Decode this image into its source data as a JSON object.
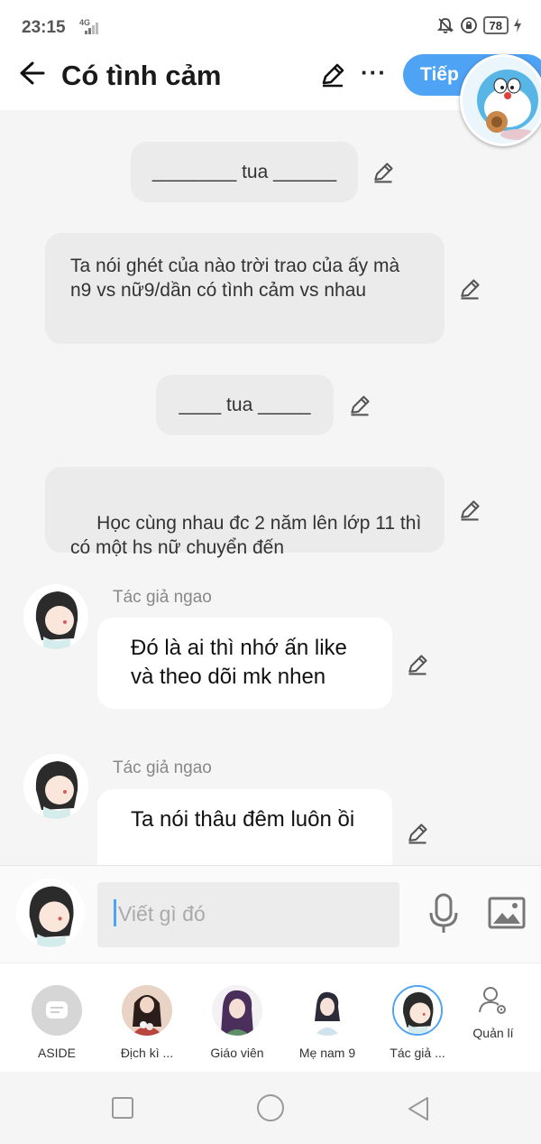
{
  "status_bar": {
    "time": "23:15",
    "network": "4G",
    "battery": "78"
  },
  "header": {
    "title": "Có tình cảm",
    "next_label": "Tiếp"
  },
  "messages": [
    {
      "text": "________ tua ______"
    },
    {
      "text": "Ta nói ghét của nào trời trao của ấy mà n9 vs nữ9/dần có tình cảm vs nhau"
    },
    {
      "text": "____ tua _____"
    },
    {
      "text": " Học cùng nhau đc 2 năm lên lớp 11 thì có một hs nữ chuyển đến"
    },
    {
      "author": "Tác giả ngao",
      "text": "Đó là ai thì nhớ ấn like và theo dõi mk nhen"
    },
    {
      "author": "Tác giả ngao",
      "text": "Ta nói thâu đêm luôn ồi"
    }
  ],
  "composer": {
    "placeholder": "Viết gì đó"
  },
  "characters": [
    {
      "name": "ASIDE"
    },
    {
      "name": "Địch kì ..."
    },
    {
      "name": "Giáo viên"
    },
    {
      "name": "Mẹ nam 9"
    },
    {
      "name": "Tác giả ..."
    }
  ],
  "manage_label": "Quản lí",
  "colors": {
    "accent": "#4ea3f5",
    "narration_bg": "#ebebeb",
    "bubble_bg": "#ffffff",
    "chat_bg": "#f5f5f5"
  }
}
